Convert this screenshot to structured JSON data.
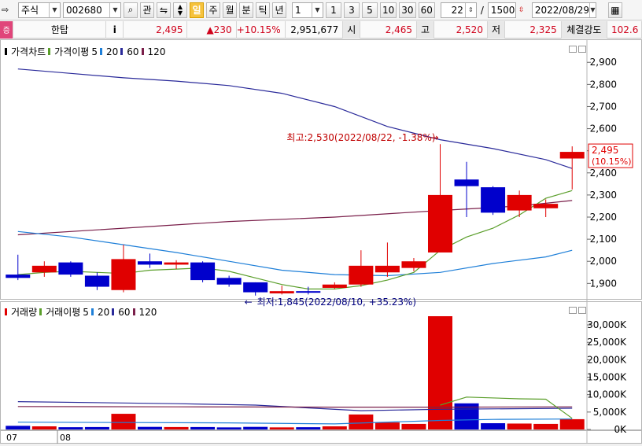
{
  "toolbar": {
    "market_type": "주식",
    "stock_code": "002680",
    "watch_label": "관",
    "period_day": "일",
    "period_week": "주",
    "period_month": "월",
    "period_minute": "분",
    "period_tick": "틱",
    "period_year": "년",
    "interval_value": "1",
    "tick_buttons": [
      "1",
      "3",
      "5",
      "10",
      "30",
      "60"
    ],
    "count_value": "22",
    "count_sep": "/",
    "count_total": "1500",
    "date_value": "2022/08/29"
  },
  "quote": {
    "badge": "증",
    "stock_name": "한탑",
    "info_icon": "i",
    "price": "2,495",
    "change": "▲230",
    "change_pct": "+10.15%",
    "volume": "2,951,677",
    "open_label": "시",
    "open": "2,465",
    "high_label": "고",
    "high": "2,520",
    "low_label": "저",
    "low": "2,325",
    "strength_label": "체결강도",
    "strength": "102.6"
  },
  "price_panel": {
    "legend_title": "가격차트",
    "legend_ma_title": "가격이평",
    "legend_ma_values": [
      "5",
      "20",
      "60",
      "120"
    ],
    "max_annotation": "최고:2,530(2022/08/22, -1.38%)",
    "min_annotation": "최저:1,845(2022/08/10, +35.23%)",
    "current_price_label": "2,495",
    "current_pct_label": "(10.15%)"
  },
  "volume_panel": {
    "legend_title": "거래량",
    "legend_ma_title": "거래이평",
    "legend_ma_values": [
      "5",
      "20",
      "60",
      "120"
    ]
  },
  "x_labels": [
    "07",
    "08"
  ],
  "colors": {
    "up": "#e00000",
    "down": "#0000cc",
    "ma5": "#5a9e2a",
    "ma20": "#1e7fd8",
    "ma60": "#2a2a9a",
    "ma120": "#7a1f4a"
  },
  "chart_data": [
    {
      "type": "candlestick",
      "title": "가격차트",
      "y_ticks": [
        1900,
        2000,
        2100,
        2200,
        2300,
        2400,
        2500,
        2600,
        2700,
        2800,
        2900
      ],
      "y_tick_labels": [
        "1,900",
        "2,000",
        "2,100",
        "2,200",
        "2,300",
        "2,400",
        "2,500",
        "2,600",
        "2,700",
        "2,800",
        "2,900"
      ],
      "ylim": [
        1830,
        2940
      ],
      "candles": [
        {
          "o": 1940,
          "c": 1925,
          "h": 2030,
          "l": 1915
        },
        {
          "o": 1950,
          "c": 1980,
          "h": 2000,
          "l": 1930
        },
        {
          "o": 1995,
          "c": 1940,
          "h": 2000,
          "l": 1930
        },
        {
          "o": 1935,
          "c": 1885,
          "h": 1950,
          "l": 1870
        },
        {
          "o": 1870,
          "c": 2010,
          "h": 2075,
          "l": 1860
        },
        {
          "o": 2000,
          "c": 1985,
          "h": 2035,
          "l": 1970
        },
        {
          "o": 1985,
          "c": 1995,
          "h": 2005,
          "l": 1965
        },
        {
          "o": 1995,
          "c": 1915,
          "h": 2000,
          "l": 1905
        },
        {
          "o": 1925,
          "c": 1895,
          "h": 1935,
          "l": 1885
        },
        {
          "o": 1905,
          "c": 1860,
          "h": 1905,
          "l": 1845
        },
        {
          "o": 1855,
          "c": 1865,
          "h": 1890,
          "l": 1850
        },
        {
          "o": 1865,
          "c": 1860,
          "h": 1885,
          "l": 1850
        },
        {
          "o": 1880,
          "c": 1895,
          "h": 1905,
          "l": 1875
        },
        {
          "o": 1895,
          "c": 1980,
          "h": 2050,
          "l": 1885
        },
        {
          "o": 1950,
          "c": 1980,
          "h": 2085,
          "l": 1930
        },
        {
          "o": 1970,
          "c": 2000,
          "h": 2015,
          "l": 1955
        },
        {
          "o": 2040,
          "c": 2300,
          "h": 2530,
          "l": 2040
        },
        {
          "o": 2370,
          "c": 2340,
          "h": 2450,
          "l": 2200
        },
        {
          "o": 2335,
          "c": 2220,
          "h": 2340,
          "l": 2210
        },
        {
          "o": 2230,
          "c": 2300,
          "h": 2320,
          "l": 2200
        },
        {
          "o": 2240,
          "c": 2260,
          "h": 2280,
          "l": 2200
        },
        {
          "o": 2465,
          "c": 2495,
          "h": 2520,
          "l": 2325
        }
      ],
      "ma5": [
        [
          0,
          1940
        ],
        [
          1,
          1950
        ],
        [
          2,
          1955
        ],
        [
          3,
          1950
        ],
        [
          4,
          1945
        ],
        [
          5,
          1960
        ],
        [
          6,
          1965
        ],
        [
          7,
          1970
        ],
        [
          8,
          1955
        ],
        [
          9,
          1925
        ],
        [
          10,
          1895
        ],
        [
          11,
          1875
        ],
        [
          12,
          1875
        ],
        [
          13,
          1890
        ],
        [
          14,
          1915
        ],
        [
          15,
          1950
        ],
        [
          16,
          2050
        ],
        [
          17,
          2110
        ],
        [
          18,
          2150
        ],
        [
          19,
          2210
        ],
        [
          20,
          2285
        ],
        [
          21,
          2320
        ]
      ],
      "ma20": [
        [
          0,
          2135
        ],
        [
          2,
          2110
        ],
        [
          4,
          2075
        ],
        [
          6,
          2040
        ],
        [
          8,
          2000
        ],
        [
          10,
          1960
        ],
        [
          12,
          1940
        ],
        [
          14,
          1935
        ],
        [
          16,
          1950
        ],
        [
          18,
          1990
        ],
        [
          20,
          2020
        ],
        [
          21,
          2050
        ]
      ],
      "ma60": [
        [
          0,
          2870
        ],
        [
          2,
          2850
        ],
        [
          4,
          2830
        ],
        [
          6,
          2815
        ],
        [
          8,
          2795
        ],
        [
          10,
          2760
        ],
        [
          12,
          2700
        ],
        [
          14,
          2610
        ],
        [
          16,
          2550
        ],
        [
          18,
          2510
        ],
        [
          20,
          2460
        ],
        [
          21,
          2420
        ]
      ],
      "ma120": [
        [
          0,
          2120
        ],
        [
          4,
          2150
        ],
        [
          8,
          2180
        ],
        [
          12,
          2200
        ],
        [
          16,
          2230
        ],
        [
          19,
          2250
        ],
        [
          21,
          2275
        ]
      ]
    },
    {
      "type": "bar",
      "title": "거래량",
      "y_ticks": [
        0,
        5000,
        10000,
        15000,
        20000,
        25000,
        30000
      ],
      "y_tick_labels": [
        "0K",
        "5,000K",
        "10,000K",
        "15,000K",
        "20,000K",
        "25,000K",
        "30,000K"
      ],
      "ylim": [
        0,
        32500
      ],
      "values": [
        1050,
        900,
        650,
        700,
        4500,
        750,
        700,
        700,
        600,
        750,
        600,
        650,
        900,
        4300,
        2000,
        1600,
        32500,
        7500,
        1800,
        1700,
        1600,
        2950
      ],
      "ma5": [
        [
          16,
          7000
        ],
        [
          17,
          9300
        ],
        [
          19,
          8800
        ],
        [
          20,
          8700
        ],
        [
          21,
          3200
        ]
      ],
      "ma20": [
        [
          0,
          2100
        ],
        [
          8,
          1900
        ],
        [
          12,
          1600
        ],
        [
          16,
          2600
        ],
        [
          18,
          2900
        ],
        [
          21,
          3000
        ]
      ],
      "ma60": [
        [
          0,
          8000
        ],
        [
          6,
          7400
        ],
        [
          9,
          7000
        ],
        [
          13,
          5400
        ],
        [
          16,
          5800
        ],
        [
          21,
          6100
        ]
      ],
      "ma120": [
        [
          0,
          6600
        ],
        [
          6,
          6500
        ],
        [
          12,
          6400
        ],
        [
          16,
          6400
        ],
        [
          21,
          6500
        ]
      ]
    }
  ]
}
